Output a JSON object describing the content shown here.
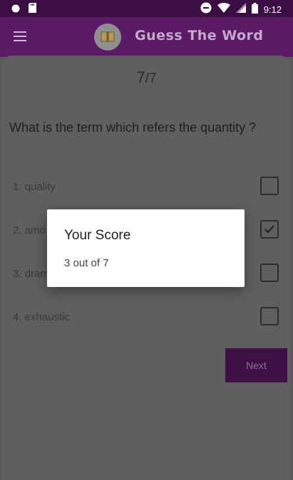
{
  "status_bar": {
    "time": "9:12"
  },
  "app_bar": {
    "title": "Guess The Word"
  },
  "quiz": {
    "counter_current": "7",
    "counter_sep": "/",
    "counter_total": "7",
    "question": "What is the term which refers the quantity ?",
    "options": [
      {
        "label": "1. quality",
        "checked": false
      },
      {
        "label": "2. amo",
        "checked": true
      },
      {
        "label": "3. dram",
        "checked": false
      },
      {
        "label": "4. exhaustic",
        "checked": false
      }
    ],
    "next_label": "Next"
  },
  "dialog": {
    "title": "Your Score",
    "message": "3 out of 7"
  },
  "colors": {
    "primary": "#5b1a66",
    "status_bar": "#3b0f44",
    "next_button": "#3e0f46"
  }
}
